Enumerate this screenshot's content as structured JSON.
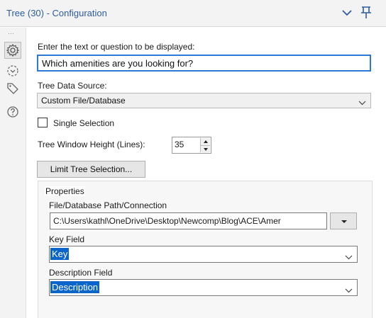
{
  "header": {
    "title": "Tree (30) - Configuration",
    "collapse_icon": "chevron-down-icon",
    "pin_icon": "pin-icon"
  },
  "sidebar": {
    "more": "…",
    "items": [
      {
        "icon": "gear-icon",
        "active": true
      },
      {
        "icon": "connection-icon",
        "active": false
      },
      {
        "icon": "tag-icon",
        "active": false
      },
      {
        "icon": "help-icon",
        "active": false
      }
    ]
  },
  "config": {
    "question_label": "Enter the text or question to be displayed:",
    "question_value": "Which amenities are you looking for?",
    "data_source_label": "Tree Data Source:",
    "data_source_value": "Custom File/Database",
    "single_selection_label": "Single Selection",
    "single_selection_checked": false,
    "height_label": "Tree Window Height (Lines):",
    "height_value": "35",
    "limit_button": "Limit Tree Selection..."
  },
  "properties": {
    "title": "Properties",
    "path_label": "File/Database Path/Connection",
    "path_value": "C:\\Users\\kathl\\OneDrive\\Desktop\\Newcomp\\Blog\\ACE\\Amer",
    "key_label": "Key Field",
    "key_value": "Key",
    "desc_label": "Description Field",
    "desc_value": "Description"
  },
  "colors": {
    "title_blue": "#2d5c9e",
    "focus_border": "#2b7bd5",
    "selection": "#0a64c9"
  }
}
